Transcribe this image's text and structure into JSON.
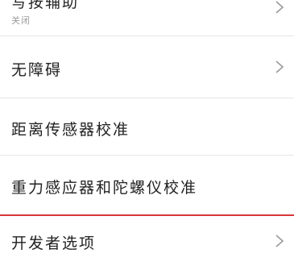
{
  "settings_list": {
    "items": [
      {
        "title": "写按辅助",
        "subtitle": "关闭",
        "has_chevron": true
      },
      {
        "title": "无障碍",
        "has_chevron": true
      },
      {
        "title": "距离传感器校准",
        "has_chevron": false
      },
      {
        "title": "重力感应器和陀螺仪校准",
        "has_chevron": false
      },
      {
        "title": "开发者选项",
        "has_chevron": true
      }
    ]
  },
  "colors": {
    "highlight_divider": "#d7353a",
    "divider": "#e6e6e6",
    "chevron": "#9a9a9a"
  },
  "icons": {
    "chevron": "chevron-right-icon"
  }
}
